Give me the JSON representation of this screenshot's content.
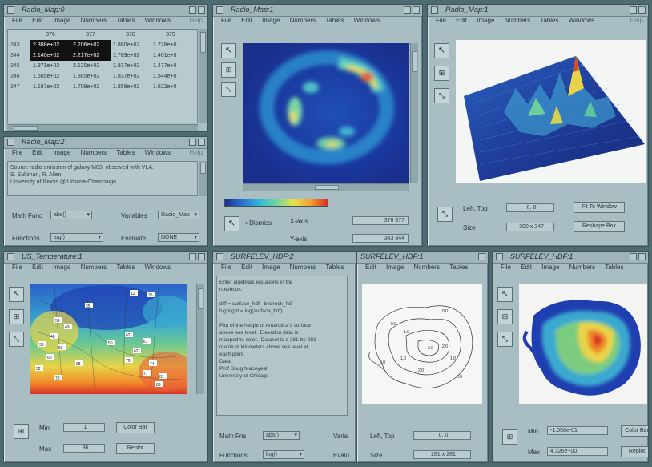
{
  "colors": {
    "desktop": "#4f6b72",
    "window": "#a9bec3",
    "selection": "#111111"
  },
  "menus": {
    "file": "File",
    "edit": "Edit",
    "image": "Image",
    "numbers": "Numbers",
    "tables": "Tables",
    "windows": "Windows",
    "help": "Help"
  },
  "w1": {
    "title": "Radio_Map:0",
    "col_headers": [
      "376",
      "377",
      "378",
      "379"
    ],
    "rows": [
      {
        "row": "343",
        "cells": [
          "2.388e+02",
          "2.206e+02",
          "1.880e+02",
          "1.228e+0"
        ]
      },
      {
        "row": "344",
        "cells": [
          "2.140e+02",
          "2.217e+02",
          "1.789e+02",
          "1.401e+0"
        ]
      },
      {
        "row": "345",
        "cells": [
          "1.871e+02",
          "2.120e+02",
          "1.837e+02",
          "1.477e+0"
        ]
      },
      {
        "row": "346",
        "cells": [
          "1.505e+02",
          "1.885e+02",
          "1.837e+02",
          "1.544e+0"
        ]
      },
      {
        "row": "347",
        "cells": [
          "1.187e+02",
          "1.709e+02",
          "1.858e+02",
          "1.622e+0"
        ]
      }
    ]
  },
  "w2": {
    "title": "Radio_Map:1",
    "dismiss": "Dismiss",
    "xaxis_label": "X-axis",
    "yaxis_label": "Y-axis",
    "xaxis_value": "376 377",
    "yaxis_value": "343 344"
  },
  "w3": {
    "title": "Radio_Map:1",
    "left_top_label": "Left, Top",
    "left_top_value": "0, 0",
    "size_label": "Size",
    "size_value": "300 x 247",
    "fit_button": "Fit To Window",
    "reshape_button": "Reshape Box"
  },
  "w4": {
    "title": "Radio_Map:2",
    "notes": "Source radio emission of galaxy M83, observed with VLA.\nS. Sulliman, R. Allen\nUniversity of Illinois @ Urbana-Champaign",
    "math_label": "Math Func",
    "math_value": "abs()",
    "variables_label": "Variables",
    "variables_value": "Radio_Map",
    "functions_label": "Functions",
    "functions_value": "log()",
    "evaluate_label": "Evaluate",
    "evaluate_value": "NONE"
  },
  "w5": {
    "title": "US_Temperature:1",
    "min_label": "Min",
    "min_value": "1",
    "max_label": "Max",
    "max_value": "96",
    "colorbar_button": "Color Bar",
    "replot_button": "Replot",
    "stations": [
      "12",
      "36",
      "35",
      "59",
      "49",
      "62",
      "48",
      "36",
      "56",
      "50",
      "61",
      "60",
      "62",
      "70",
      "68",
      "74",
      "52",
      "77",
      "79",
      "81",
      "83"
    ]
  },
  "w6": {
    "title": "SURFELEV_HDF:2",
    "notes": "Enter algebraic equations in the\nnotebook:\n\ndiff = surface_hdf - bedrock_hdf\nhighlight = log(surface_hdf)\n\nPlot of the height of Antarctica's surface\nabove sea level.  Elevation data is\nmapped to color.  Dataset is a 281-by-281\nmatrix of kilometers above sea level at\neach point.\nData:\nProf Doug MacAyeal\nUniversity of Chicago",
    "math_label": "Math Fns",
    "math_value": "abs()",
    "functions_label": "Functions",
    "functions_value": "log()",
    "variables_label": "Varia",
    "evaluate_label": "Evalu"
  },
  "w7": {
    "title": "SURFELEV_HDF:1",
    "left_top_label": "Left, Top",
    "left_top_value": "0, 0",
    "size_label": "Size",
    "size_value": "281 x 281",
    "contours": [
      "0.0",
      "0.0",
      "1.0",
      "3.0",
      "2.0",
      "1.0",
      "0.0",
      "1.0",
      "2.0",
      "0.0"
    ]
  },
  "w8": {
    "title": "SURFELEV_HDF:1",
    "min_label": "Min",
    "min_value": "-1.058e-01",
    "max_label": "Max",
    "max_value": "4.326e+00",
    "colorbar_button": "Color Bar",
    "replot_button": "Replot"
  }
}
